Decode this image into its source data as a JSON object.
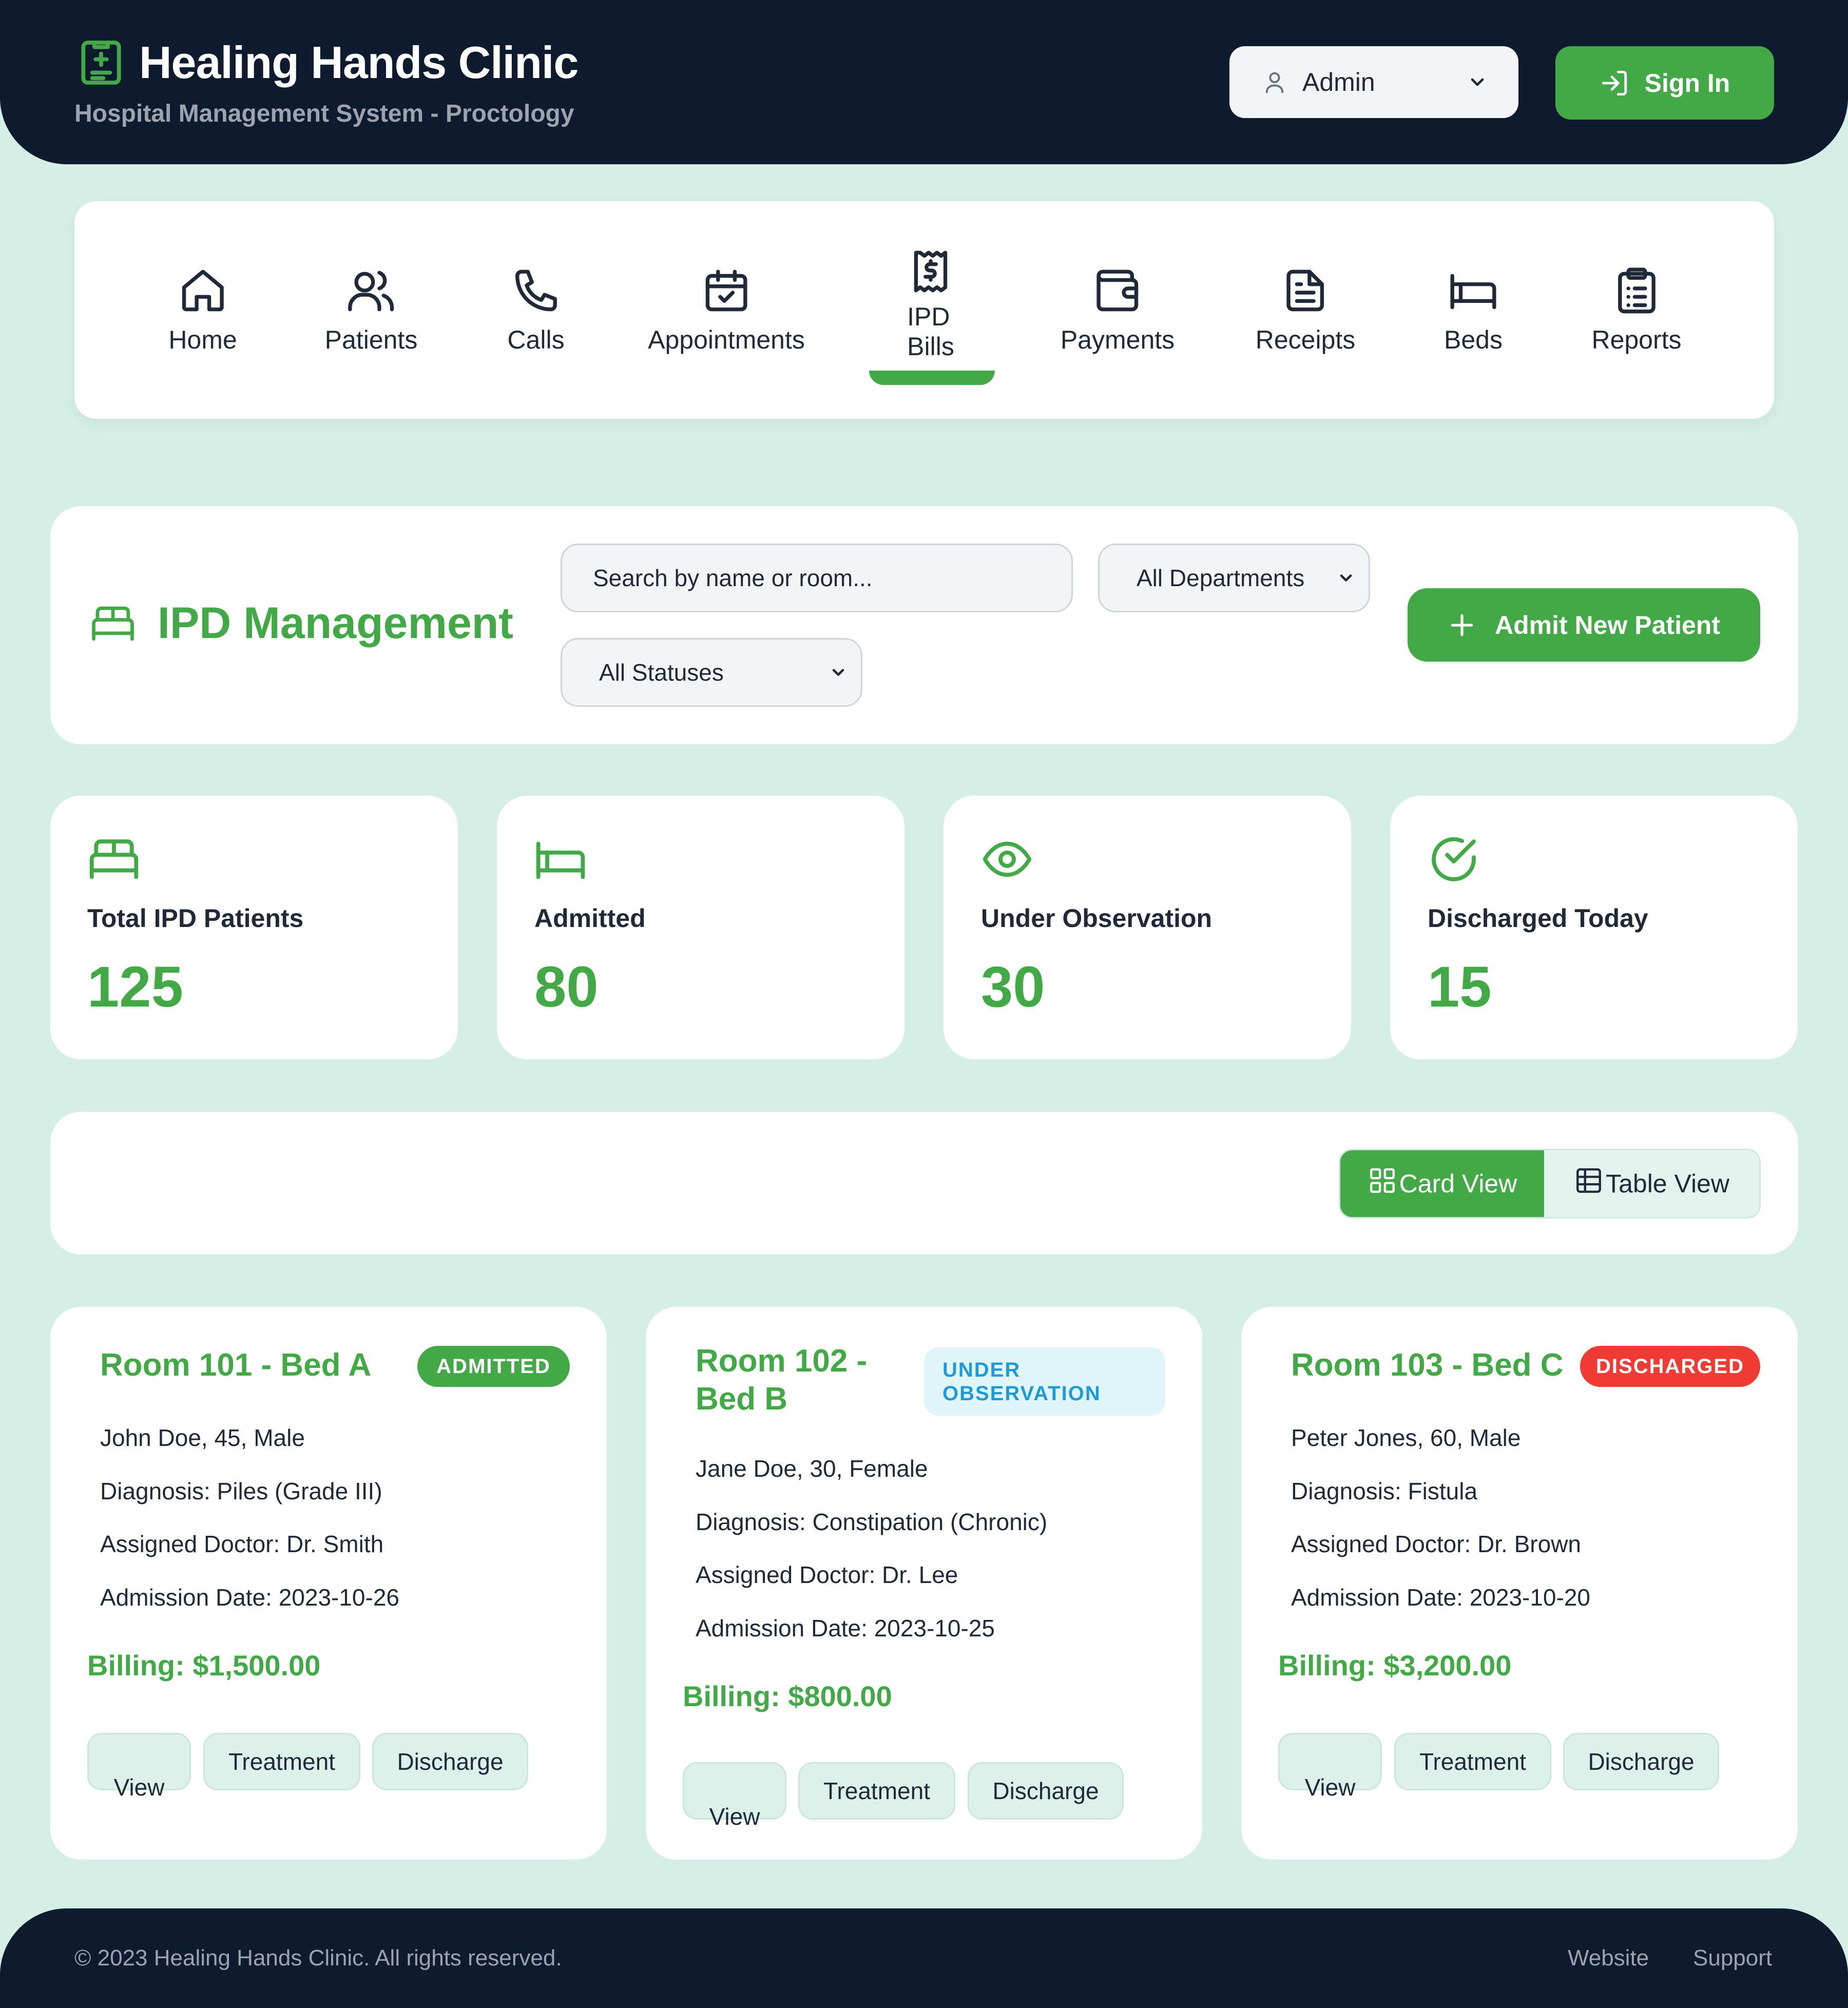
{
  "header": {
    "title": "Healing Hands Clinic",
    "subtitle": "Hospital Management System - Proctology",
    "role": "Admin",
    "signin_label": "Sign In"
  },
  "nav": {
    "items": [
      {
        "label": "Home",
        "icon": "home-icon"
      },
      {
        "label": "Patients",
        "icon": "users-icon"
      },
      {
        "label": "Calls",
        "icon": "phone-icon"
      },
      {
        "label": "Appointments",
        "icon": "calendar-check-icon"
      },
      {
        "label": "IPD\nBills",
        "icon": "receipt-dollar-icon",
        "active": true
      },
      {
        "label": "Payments",
        "icon": "wallet-icon"
      },
      {
        "label": "Receipts",
        "icon": "document-icon"
      },
      {
        "label": "Beds",
        "icon": "bed-icon"
      },
      {
        "label": "Reports",
        "icon": "clipboard-list-icon"
      }
    ]
  },
  "ipd": {
    "title": "IPD Management",
    "search_placeholder": "Search by name or room...",
    "department_filter": "All Departments",
    "status_filter": "All Statuses",
    "admit_label": "Admit New Patient"
  },
  "stats": [
    {
      "label": "Total IPD Patients",
      "value": "125",
      "icon": "bed-double-icon"
    },
    {
      "label": "Admitted",
      "value": "80",
      "icon": "bed-icon"
    },
    {
      "label": "Under Observation",
      "value": "30",
      "icon": "eye-icon"
    },
    {
      "label": "Discharged Today",
      "value": "15",
      "icon": "check-circle-icon"
    }
  ],
  "view_toggle": {
    "card_label": "Card View",
    "table_label": "Table View",
    "active": "card"
  },
  "patients": [
    {
      "room": "Room 101 - Bed A",
      "status": "ADMITTED",
      "info": "John Doe, 45, Male",
      "diagnosis": "Diagnosis: Piles (Grade III)",
      "doctor": "Assigned Doctor: Dr. Smith",
      "admission": "Admission Date: 2023-10-26",
      "billing": "Billing: $1,500.00"
    },
    {
      "room_line1": "Room 102 -",
      "room_line2": "Bed B",
      "status_line1": "UNDER",
      "status_line2": "OBSERVATION",
      "info": "Jane Doe, 30, Female",
      "diagnosis": "Diagnosis: Constipation (Chronic)",
      "doctor": "Assigned Doctor: Dr. Lee",
      "admission": "Admission Date: 2023-10-25",
      "billing": "Billing: $800.00"
    },
    {
      "room": "Room 103 - Bed C",
      "status": "DISCHARGED",
      "info": "Peter Jones, 60, Male",
      "diagnosis": "Diagnosis: Fistula",
      "doctor": "Assigned Doctor: Dr. Brown",
      "admission": "Admission Date: 2023-10-20",
      "billing": "Billing: $3,200.00"
    }
  ],
  "actions": {
    "view": "View",
    "treatment": "Treatment",
    "discharge": "Discharge"
  },
  "footer": {
    "copyright": "© 2023 Healing Hands Clinic. All rights reserved.",
    "links": [
      "Website",
      "Support"
    ]
  },
  "colors": {
    "brand_green": "#43a947",
    "navy": "#0e1a2e",
    "background": "#d5efe7",
    "observation_blue": "#1e9bd7",
    "discharged_red": "#ef3b33"
  }
}
